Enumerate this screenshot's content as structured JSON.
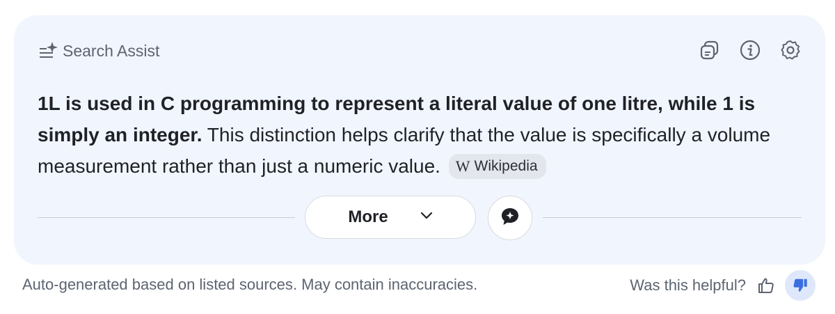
{
  "header": {
    "title": "Search Assist",
    "icons": [
      "search-assist-sparkle-icon",
      "sources-icon",
      "info-icon",
      "settings-gear-icon"
    ]
  },
  "answer": {
    "bold_text": "1L is used in C programming to represent a literal value of one litre, while 1 is simply an integer.",
    "regular_text": " This distinction helps clarify that the value is specifically a volume measurement rather than just a numeric value.",
    "source_chip": {
      "glyph": "W",
      "label": "Wikipedia"
    }
  },
  "actions": {
    "more_label": "More",
    "more_icon": "chevron-down-icon",
    "chat_icon": "chat-bubble-icon"
  },
  "footer": {
    "disclaimer": "Auto-generated based on listed sources. May contain inaccuracies.",
    "helpful_question": "Was this helpful?",
    "thumb_up_icon": "thumbs-up-icon",
    "thumb_down_icon": "thumbs-down-icon"
  },
  "colors": {
    "card_background": "#f1f5fd",
    "text_primary": "#1f2126",
    "text_secondary": "#5d6470",
    "accent_blue": "#3b6fe0"
  }
}
